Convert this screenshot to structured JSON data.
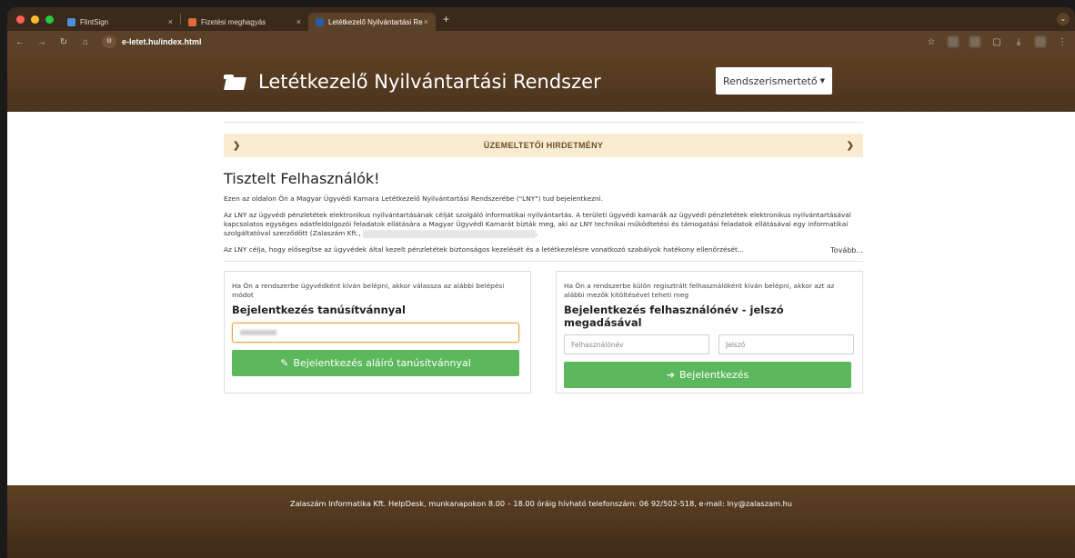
{
  "browser": {
    "tabs": [
      {
        "title": "FlintSign",
        "icon_color": "#4a90d9"
      },
      {
        "title": "Fizetési meghagyás",
        "icon_color": "#e06b3c"
      },
      {
        "title": "Letétkezelő Nyilvántartási Re",
        "icon_color": "#2b5ca8"
      }
    ],
    "new_tab": "+",
    "url": "e-letet.hu/index.html"
  },
  "header": {
    "title": "Letétkezelő Nyilvántartási Rendszer",
    "system_menu_label": "Rendszerismertető",
    "brand_color": "#4f361f"
  },
  "notice": {
    "label": "ÜZEMELTETŐI HIRDETMÉNY",
    "bg_color": "#f9ecd0"
  },
  "intro": {
    "heading": "Tisztelt Felhasználók!",
    "p1": "Ezen az oldalon Ön a Magyar Ügyvédi Kamara Letétkezelő Nyilvántartási Rendszerébe (\"LNY\") tud bejelentkezni.",
    "p2_start": "Az LNY az ügyvédi pénzletétek elektronikus nyilvántartásának célját szolgáló informatikai nyilvántartás. A területi ügyvédi kamarák az ügyvédi pénzletétek elektronikus nyilvántartásával kapcsolatos egységes adatfeldolgozói feladatok ellátására a Magyar Ügyvédi Kamarát bízták meg, aki az LNY technikai működtetési és támogatási feladatok ellátásával egy informatikai szolgáltatóval szerződött (Zalaszám Kft.,",
    "p2_end": ".",
    "p3": "Az LNY célja, hogy elősegítse az ügyvédek által kezelt pénzletétek biztonságos kezelését és a letétkezelésre vonatkozó szabályok hatékony ellenőrzését...",
    "more": "Tovább..."
  },
  "cert_login": {
    "intro": "Ha Ön a rendszerbe ügyvédként kíván belépni, akkor válassza az alábbi belépési módot",
    "heading": "Bejelentkezés tanúsítvánnyal",
    "button": "Bejelentkezés aláíró tanúsítvánnyal",
    "button_color": "#5cb85c"
  },
  "user_login": {
    "intro": "Ha Ön a rendszerbe külön regisztrált felhasználóként kíván belépni, akkor azt az alábbi mezők kitöltésével teheti meg",
    "heading": "Bejelentkezés felhasználónév - jelszó megadásával",
    "username_placeholder": "Felhasználónév",
    "password_placeholder": "Jelszó",
    "button": "Bejelentkezés"
  },
  "footer": {
    "text": "Zalaszám Informatika Kft. HelpDesk, munkanapokon 8.00 – 18.00 óráig hívható telefonszám: 06 92/502-518, e-mail: lny@zalaszam.hu"
  }
}
